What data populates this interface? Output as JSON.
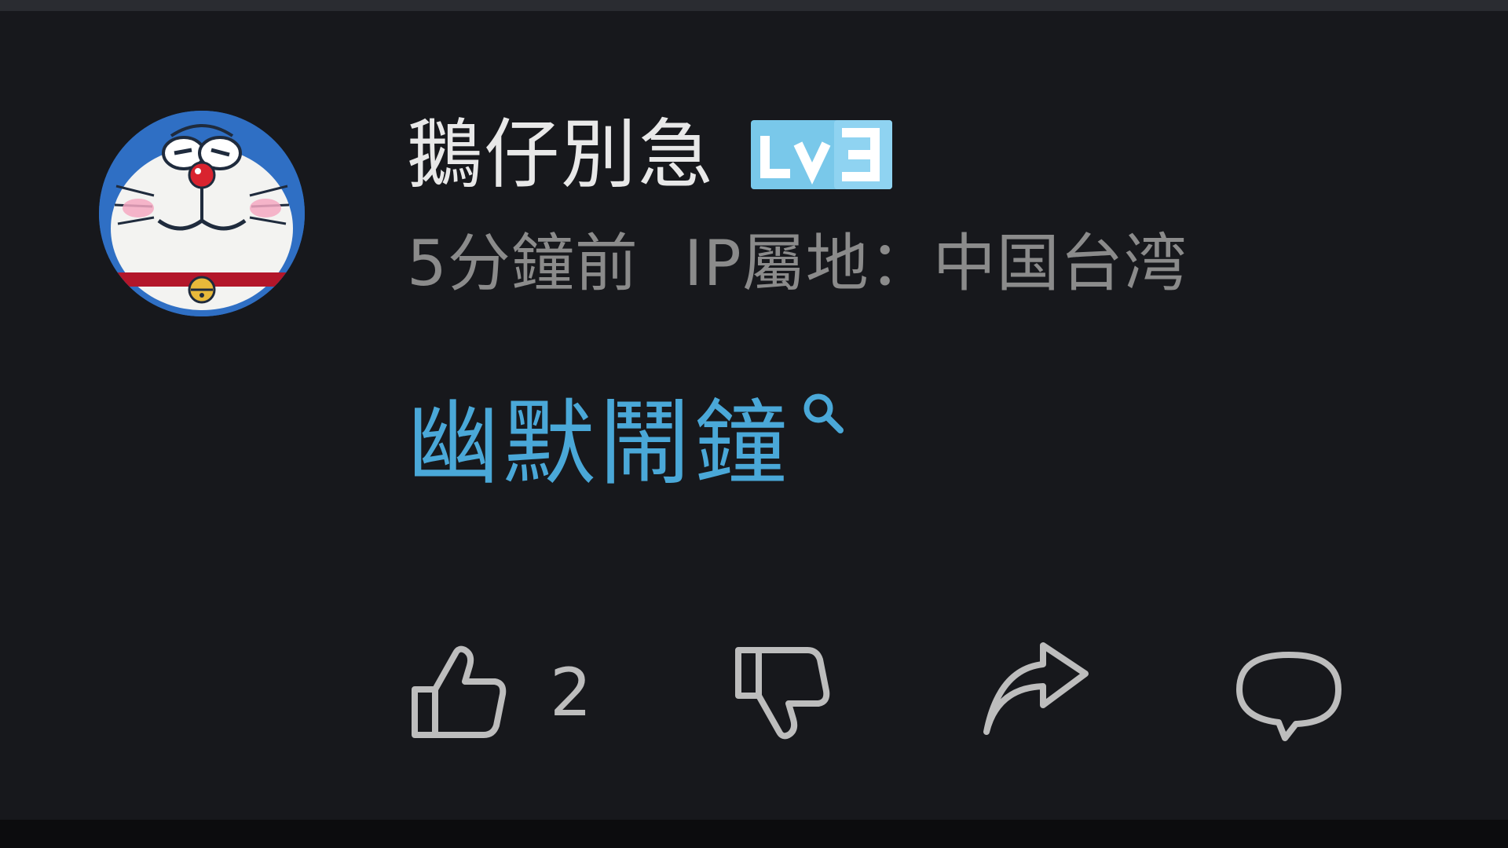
{
  "comment": {
    "username": "鵝仔別急",
    "level": "LV3",
    "time_ago": "5分鐘前",
    "ip_location": "IP屬地：中国台湾",
    "body": "幽默鬧鐘",
    "likes": "2"
  },
  "icons": {
    "avatar": "doraemon-avatar",
    "badge": "level-3-badge",
    "search": "search-icon",
    "like": "thumbs-up-icon",
    "dislike": "thumbs-down-icon",
    "share": "share-arrow-icon",
    "reply": "reply-bubble-icon"
  },
  "colors": {
    "background": "#17181c",
    "link": "#4aa8d8",
    "badge": "#79c8ea",
    "muted": "#8b8b8b",
    "icon": "#bdbdbd"
  }
}
